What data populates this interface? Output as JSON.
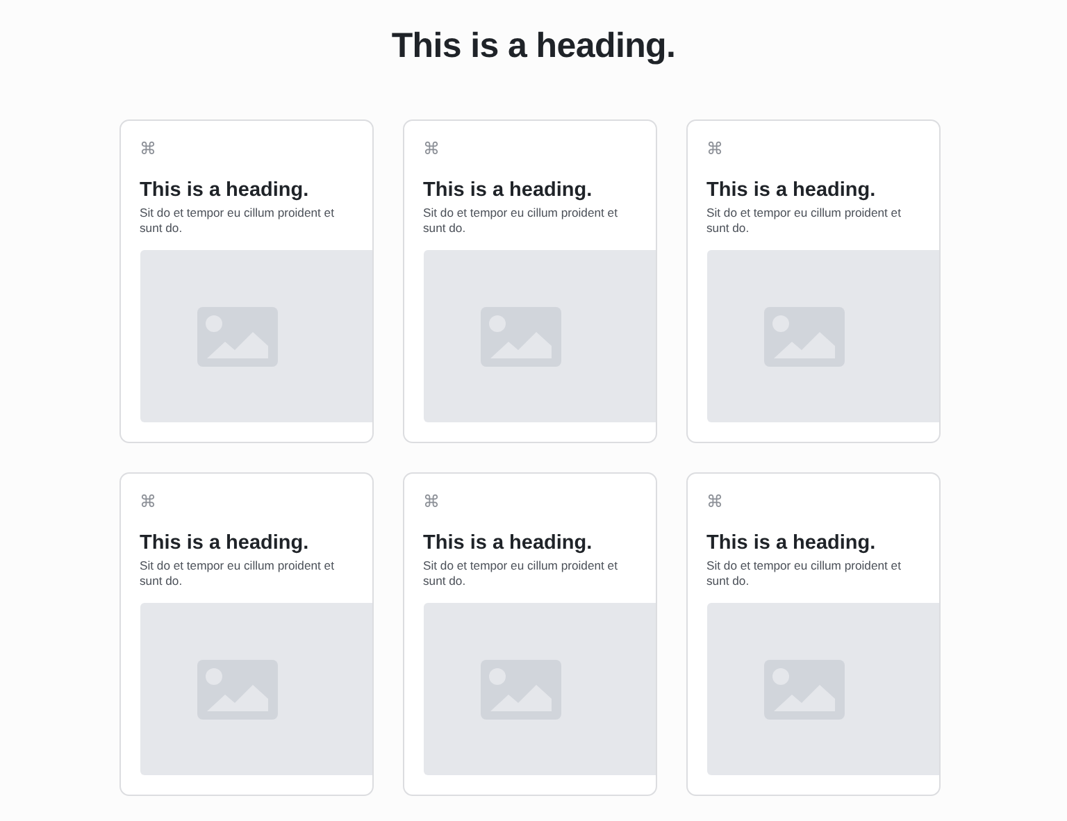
{
  "title": "This is a heading.",
  "cards": [
    {
      "icon": "⌘",
      "heading": "This is a heading.",
      "text": "Sit do et tempor eu cillum proident et sunt do."
    },
    {
      "icon": "⌘",
      "heading": "This is a heading.",
      "text": "Sit do et tempor eu cillum proident et sunt do."
    },
    {
      "icon": "⌘",
      "heading": "This is a heading.",
      "text": "Sit do et tempor eu cillum proident et sunt do."
    },
    {
      "icon": "⌘",
      "heading": "This is a heading.",
      "text": "Sit do et tempor eu cillum proident et sunt do."
    },
    {
      "icon": "⌘",
      "heading": "This is a heading.",
      "text": "Sit do et tempor eu cillum proident et sunt do."
    },
    {
      "icon": "⌘",
      "heading": "This is a heading.",
      "text": "Sit do et tempor eu cillum proident et sunt do."
    }
  ]
}
